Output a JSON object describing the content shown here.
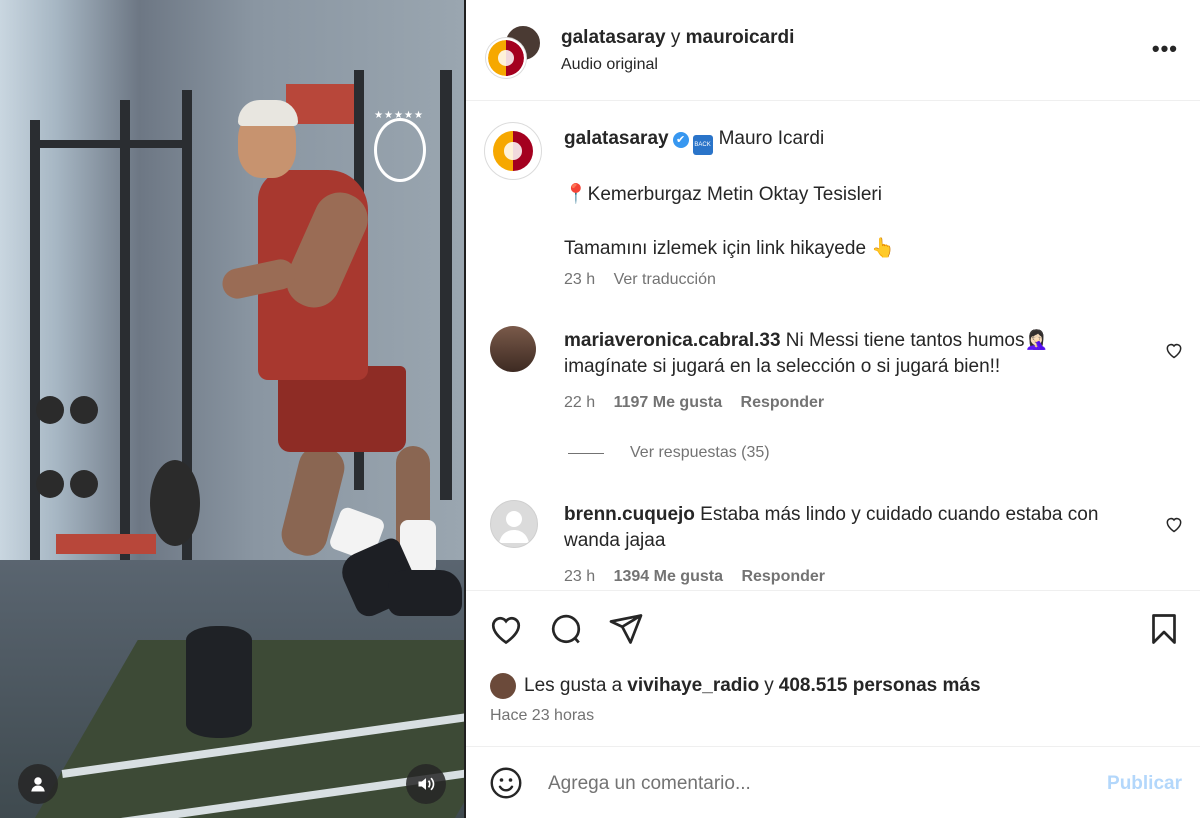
{
  "header": {
    "account1": "galatasaray",
    "connector": " y ",
    "account2": "mauroicardi",
    "subtitle": "Audio original",
    "more": "•••"
  },
  "caption": {
    "username": "galatasaray",
    "verified_glyph": "✔",
    "back_badge": "BACK",
    "title": "Mauro Icardi",
    "pin": "📍",
    "location": "Kemerburgaz Metin Oktay Tesisleri",
    "cta": "Tamamını izlemek için link hikayede 👆",
    "time": "23 h",
    "translate": "Ver traducción"
  },
  "comments": [
    {
      "username": "mariaveronica.cabral.33",
      "text": " Ni Messi tiene tantos humos🤦🏻‍♀️",
      "text2": "imagínate si jugará en la selección o si jugará bien!!",
      "time": "22 h",
      "likes": "1197 Me gusta",
      "reply": "Responder"
    },
    {
      "username": "brenn.cuquejo",
      "text": " Estaba más lindo y cuidado cuando estaba con",
      "text2": "wanda jajaa",
      "time": "23 h",
      "likes": "1394 Me gusta",
      "reply": "Responder"
    }
  ],
  "replies_label": "Ver respuestas (35)",
  "likes_line": {
    "prefix": "Les gusta a ",
    "user": "vivihaye_radio",
    "middle": " y ",
    "count": "408.515 personas más"
  },
  "posted_ago": "Hace 23 horas",
  "composer": {
    "placeholder": "Agrega un comentario...",
    "publish": "Publicar"
  },
  "colors": {
    "accent": "#0095f6",
    "publish_disabled": "#b3d7fb",
    "verified": "#3797f0"
  }
}
